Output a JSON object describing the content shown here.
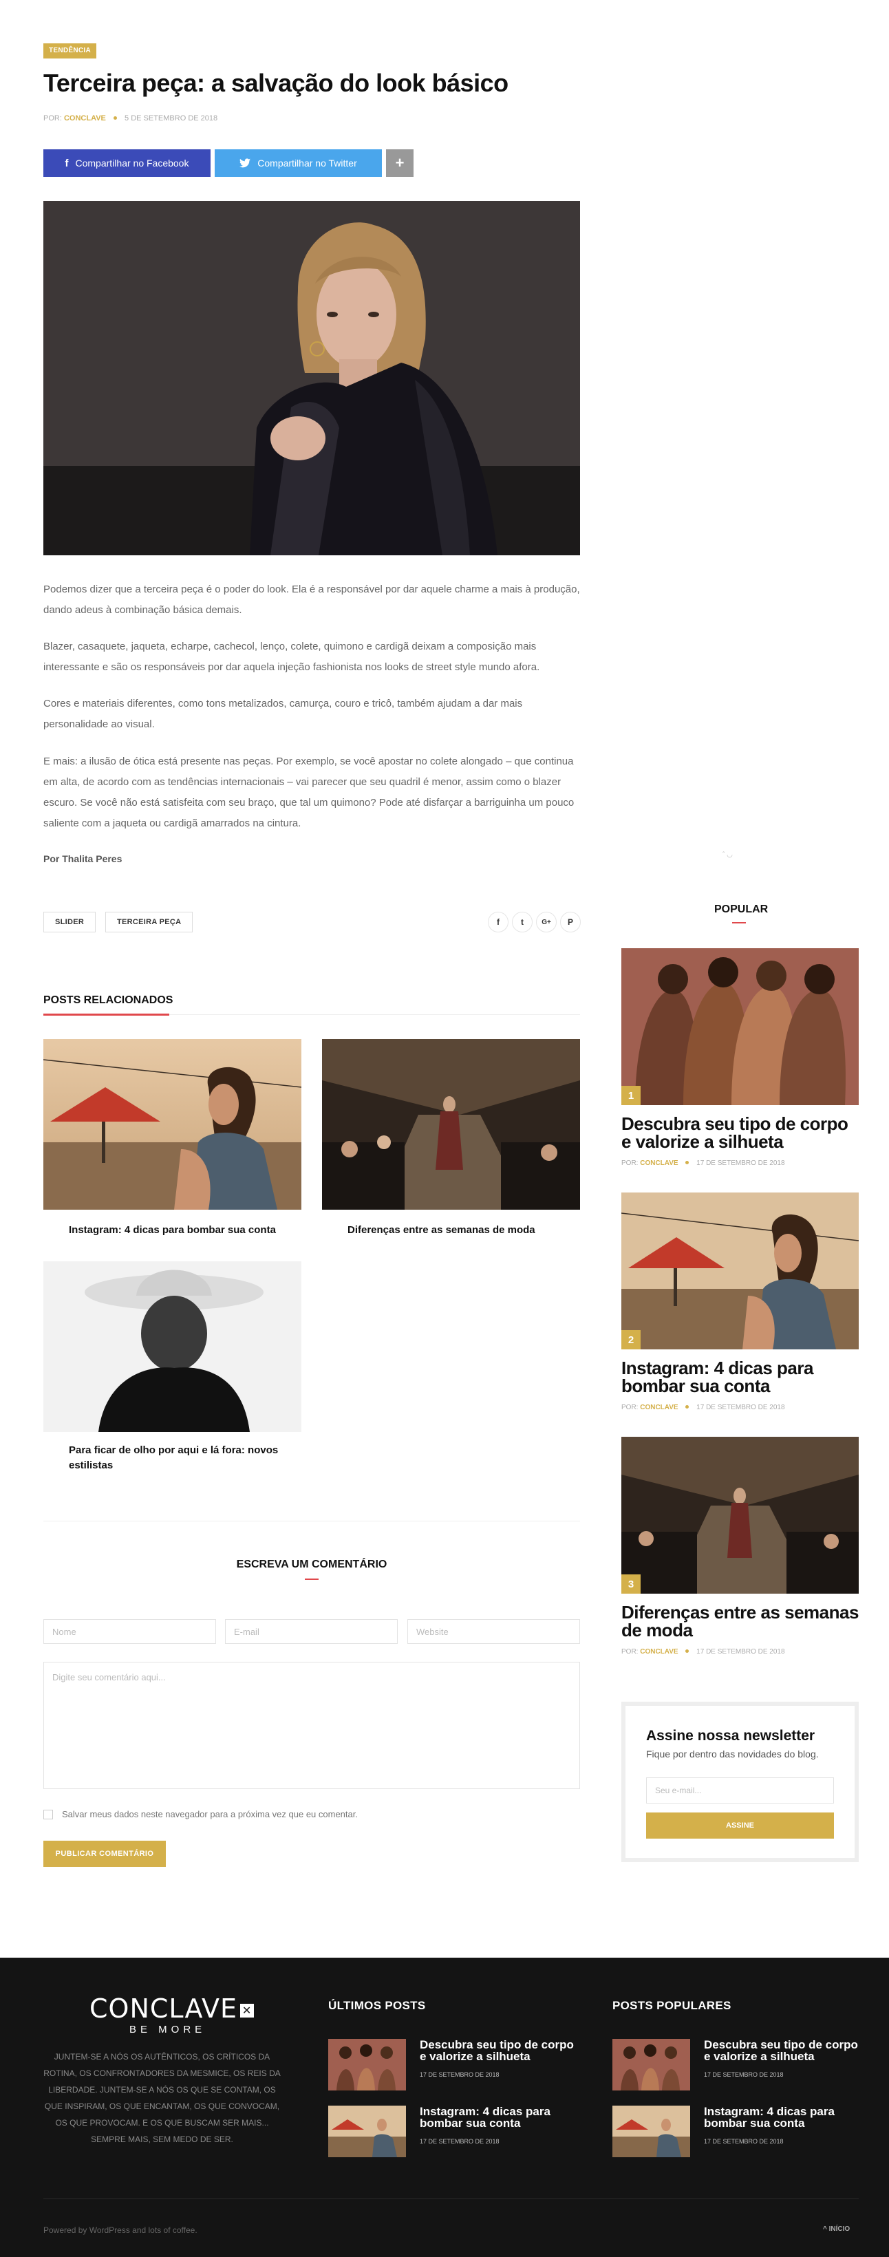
{
  "post": {
    "category": "TENDÊNCIA",
    "title": "Terceira peça: a salvação do look básico",
    "by": "POR:",
    "author": "CONCLAVE",
    "date": "5 DE SETEMBRO DE 2018",
    "share_facebook": "Compartilhar no Facebook",
    "share_twitter": "Compartilhar no Twitter",
    "share_more": "+",
    "paragraphs": [
      "Podemos dizer que a terceira peça é o poder do look. Ela é a responsável por dar aquele charme a mais à produção, dando adeus à combinação básica demais.",
      "Blazer, casaquete, jaqueta, echarpe, cachecol, lenço, colete, quimono e cardigã deixam a composição mais interessante e são os responsáveis por dar aquela injeção fashionista nos looks de street style mundo afora.",
      "Cores e materiais diferentes, como tons metalizados, camurça, couro e tricô, também ajudam a dar mais personalidade ao visual.",
      "E mais: a ilusão de ótica está presente nas peças. Por exemplo, se você apostar no colete alongado – que continua em alta, de acordo com as tendências internacionais – vai parecer que seu quadril é menor, assim como o blazer escuro. Se você não está satisfeita com seu braço, que tal um quimono? Pode até disfarçar a barriguinha um pouco saliente com a jaqueta ou cardigã amarrados na cintura."
    ],
    "byline": "Por Thalita Peres",
    "tags": [
      "SLIDER",
      "TERCEIRA PEÇA"
    ],
    "share_icons": [
      "f",
      "t",
      "G+",
      "P"
    ]
  },
  "related": {
    "heading": "POSTS RELACIONADOS",
    "items": [
      {
        "title": "Instagram: 4 dicas para bombar sua conta"
      },
      {
        "title": "Diferenças entre as semanas de moda"
      },
      {
        "title": "Para ficar de olho por aqui e lá fora: novos estilistas"
      }
    ]
  },
  "comment_form": {
    "heading": "ESCREVA UM COMENTÁRIO",
    "name_placeholder": "Nome",
    "email_placeholder": "E-mail",
    "website_placeholder": "Website",
    "comment_placeholder": "Digite seu comentário aqui...",
    "save_label": "Salvar meus dados neste navegador para a próxima vez que eu comentar.",
    "submit": "PUBLICAR COMENTÁRIO"
  },
  "sidebar": {
    "popular_heading": "POPULAR",
    "popular": [
      {
        "num": "1",
        "title": "Descubra seu tipo de corpo e valorize a silhueta",
        "by": "POR:",
        "author": "CONCLAVE",
        "date": "17 DE SETEMBRO DE 2018"
      },
      {
        "num": "2",
        "title": "Instagram: 4 dicas para bombar sua conta",
        "by": "POR:",
        "author": "CONCLAVE",
        "date": "17 DE SETEMBRO DE 2018"
      },
      {
        "num": "3",
        "title": "Diferenças entre as semanas de moda",
        "by": "POR:",
        "author": "CONCLAVE",
        "date": "17 DE SETEMBRO DE 2018"
      }
    ],
    "newsletter": {
      "title": "Assine nossa newsletter",
      "subtitle": "Fique por dentro das novidades do blog.",
      "email_placeholder": "Seu e-mail...",
      "button": "ASSINE"
    }
  },
  "footer": {
    "logo_text": "CONCLAVE",
    "logo_tagline": "BE MORE",
    "about": "JUNTEM-SE A NÓS OS AUTÊNTICOS, OS CRÍTICOS DA ROTINA, OS CONFRONTADORES DA MESMICE, OS REIS DA LIBERDADE. JUNTEM-SE A NÓS OS QUE SE CONTAM, OS QUE INSPIRAM, OS QUE ENCANTAM, OS QUE CONVOCAM, OS QUE PROVOCAM. E OS QUE BUSCAM SER MAIS... SEMPRE MAIS, SEM MEDO DE SER.",
    "latest_heading": "ÚLTIMOS POSTS",
    "popular_heading": "POSTS POPULARES",
    "latest": [
      {
        "title": "Descubra seu tipo de corpo e valorize a silhueta",
        "date": "17 DE SETEMBRO DE 2018"
      },
      {
        "title": "Instagram: 4 dicas para bombar sua conta",
        "date": "17 DE SETEMBRO DE 2018"
      }
    ],
    "popular": [
      {
        "title": "Descubra seu tipo de corpo e valorize a silhueta",
        "date": "17 DE SETEMBRO DE 2018"
      },
      {
        "title": "Instagram: 4 dicas para bombar sua conta",
        "date": "17 DE SETEMBRO DE 2018"
      }
    ],
    "credits": "Powered by WordPress and lots of coffee.",
    "back_to_top": "^ INÍCIO"
  },
  "colors": {
    "accent": "#d4b04a",
    "facebook": "#3b4bb8",
    "twitter": "#4aa6ec",
    "footer_bg": "#141414"
  }
}
